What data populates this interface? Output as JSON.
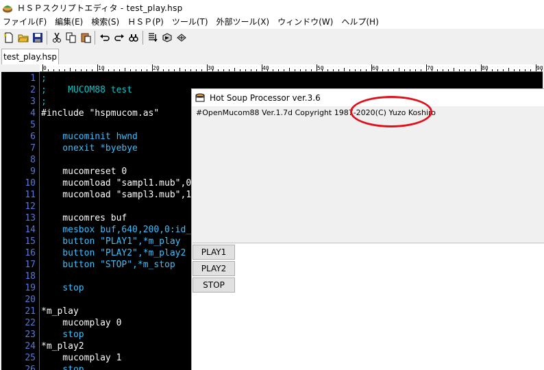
{
  "window": {
    "title": "ＨＳＰスクリプトエディタ - test_play.hsp"
  },
  "menu": [
    "ファイル(F)",
    "編集(E)",
    "検索(S)",
    "ＨＳＰ(P)",
    "ツール(T)",
    "外部ツール(X)",
    "ウィンドウ(W)",
    "ヘルプ(H)"
  ],
  "toolbar": {
    "buttons": [
      "new-file-icon",
      "open-folder-icon",
      "save-icon",
      "cut-icon",
      "copy-icon",
      "paste-icon",
      "undo-icon",
      "redo-icon",
      "find-icon",
      "compile-icon",
      "run-icon",
      "build-icon"
    ]
  },
  "tabs": [
    {
      "label": "test_play.hsp"
    }
  ],
  "ruler": {
    "marks": [
      "0",
      "10",
      "20",
      "30",
      "40",
      "50",
      "60",
      "70",
      "80",
      "90"
    ]
  },
  "code": [
    {
      "n": "1",
      "text": ";",
      "type": "comment"
    },
    {
      "n": "2",
      "text": ";    MUCOM88 test",
      "type": "comment"
    },
    {
      "n": "3",
      "text": ";",
      "type": "comment"
    },
    {
      "n": "4",
      "text": "#include \"hspmucom.as\"",
      "type": "pp"
    },
    {
      "n": "5",
      "text": "",
      "type": "txt"
    },
    {
      "n": "6",
      "text": "    mucominit hwnd",
      "type": "kw"
    },
    {
      "n": "7",
      "text": "    onexit *byebye",
      "type": "kw"
    },
    {
      "n": "8",
      "text": "",
      "type": "txt"
    },
    {
      "n": "9",
      "text": "    mucomreset 0",
      "type": "txt"
    },
    {
      "n": "10",
      "text": "    mucomload \"sampl1.mub\",0",
      "type": "txt"
    },
    {
      "n": "11",
      "text": "    mucomload \"sampl3.mub\",1",
      "type": "txt"
    },
    {
      "n": "12",
      "text": "",
      "type": "txt"
    },
    {
      "n": "13",
      "text": "    mucomres buf",
      "type": "txt"
    },
    {
      "n": "14",
      "text": "    mesbox buf,640,200,0:id_",
      "type": "kw"
    },
    {
      "n": "15",
      "text": "    button \"PLAY1\",*m_play",
      "type": "kw"
    },
    {
      "n": "16",
      "text": "    button \"PLAY2\",*m_play2",
      "type": "kw"
    },
    {
      "n": "17",
      "text": "    button \"STOP\",*m_stop",
      "type": "kw"
    },
    {
      "n": "18",
      "text": "",
      "type": "txt"
    },
    {
      "n": "19",
      "text": "    stop",
      "type": "kw"
    },
    {
      "n": "20",
      "text": "",
      "type": "txt"
    },
    {
      "n": "21",
      "text": "*m_play",
      "type": "label"
    },
    {
      "n": "22",
      "text": "    mucomplay 0",
      "type": "txt"
    },
    {
      "n": "23",
      "text": "    stop",
      "type": "kw"
    },
    {
      "n": "24",
      "text": "*m_play2",
      "type": "label"
    },
    {
      "n": "25",
      "text": "    mucomplay 1",
      "type": "txt"
    },
    {
      "n": "26",
      "text": "    stop",
      "type": "kw"
    }
  ],
  "hsp_window": {
    "title": "Hot Soup Processor ver.3.6",
    "mesbox_text": "#OpenMucom88 Ver.1.7d Copyright 1987-2020(C) Yuzo Koshiro",
    "buttons": [
      "PLAY1",
      "PLAY2",
      "STOP"
    ]
  },
  "colors": {
    "editor_bg": "#000000",
    "comment": "#00c8c8",
    "keyword": "#3cc0ff",
    "line_number": "#5a7ad8",
    "annotation": "#e0101a"
  }
}
